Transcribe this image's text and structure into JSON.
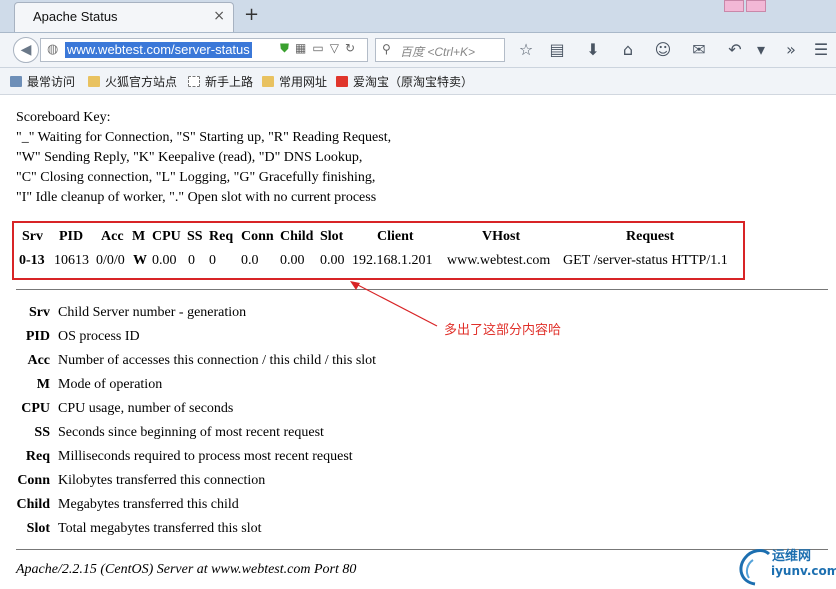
{
  "tab": {
    "title": "Apache Status",
    "close": "×"
  },
  "newtab": "+",
  "nav": {
    "url": "www.webtest.com/server-status",
    "search_placeholder": "百度 <Ctrl+K>"
  },
  "bookmarks": [
    "最常访问",
    "火狐官方站点",
    "新手上路",
    "常用网址",
    "爱淘宝（原淘宝特卖）"
  ],
  "scoreboard": {
    "title": "Scoreboard Key:",
    "lines": [
      "\"_\" Waiting for Connection, \"S\" Starting up, \"R\" Reading Request,",
      "\"W\" Sending Reply, \"K\" Keepalive (read), \"D\" DNS Lookup,",
      "\"C\" Closing connection, \"L\" Logging, \"G\" Gracefully finishing,",
      "\"I\" Idle cleanup of worker, \".\" Open slot with no current process"
    ]
  },
  "table": {
    "headers": [
      "Srv",
      "PID",
      "Acc",
      "M",
      "CPU",
      "SS",
      "Req",
      "Conn",
      "Child",
      "Slot",
      "Client",
      "VHost",
      "Request"
    ],
    "row": [
      "0-13",
      "10613",
      "0/0/0",
      "W",
      "0.00",
      "0",
      "0",
      "0.0",
      "0.00",
      "0.00",
      "192.168.1.201",
      "www.webtest.com",
      "GET /server-status HTTP/1.1"
    ]
  },
  "definitions": [
    {
      "key": "Srv",
      "text": "Child Server number - generation"
    },
    {
      "key": "PID",
      "text": "OS process ID"
    },
    {
      "key": "Acc",
      "text": "Number of accesses this connection / this child / this slot"
    },
    {
      "key": "M",
      "text": "Mode of operation"
    },
    {
      "key": "CPU",
      "text": "CPU usage, number of seconds"
    },
    {
      "key": "SS",
      "text": "Seconds since beginning of most recent request"
    },
    {
      "key": "Req",
      "text": "Milliseconds required to process most recent request"
    },
    {
      "key": "Conn",
      "text": "Kilobytes transferred this connection"
    },
    {
      "key": "Child",
      "text": "Megabytes transferred this child"
    },
    {
      "key": "Slot",
      "text": "Total megabytes transferred this slot"
    }
  ],
  "footer": "Apache/2.2.15 (CentOS) Server at www.webtest.com Port 80",
  "annotation": "多出了这部分内容哈",
  "watermark": {
    "line1": "运维网",
    "line2": "iyunv.com"
  },
  "colors": {
    "highlight_box": "#d82426",
    "annotation": "#e0302a"
  }
}
